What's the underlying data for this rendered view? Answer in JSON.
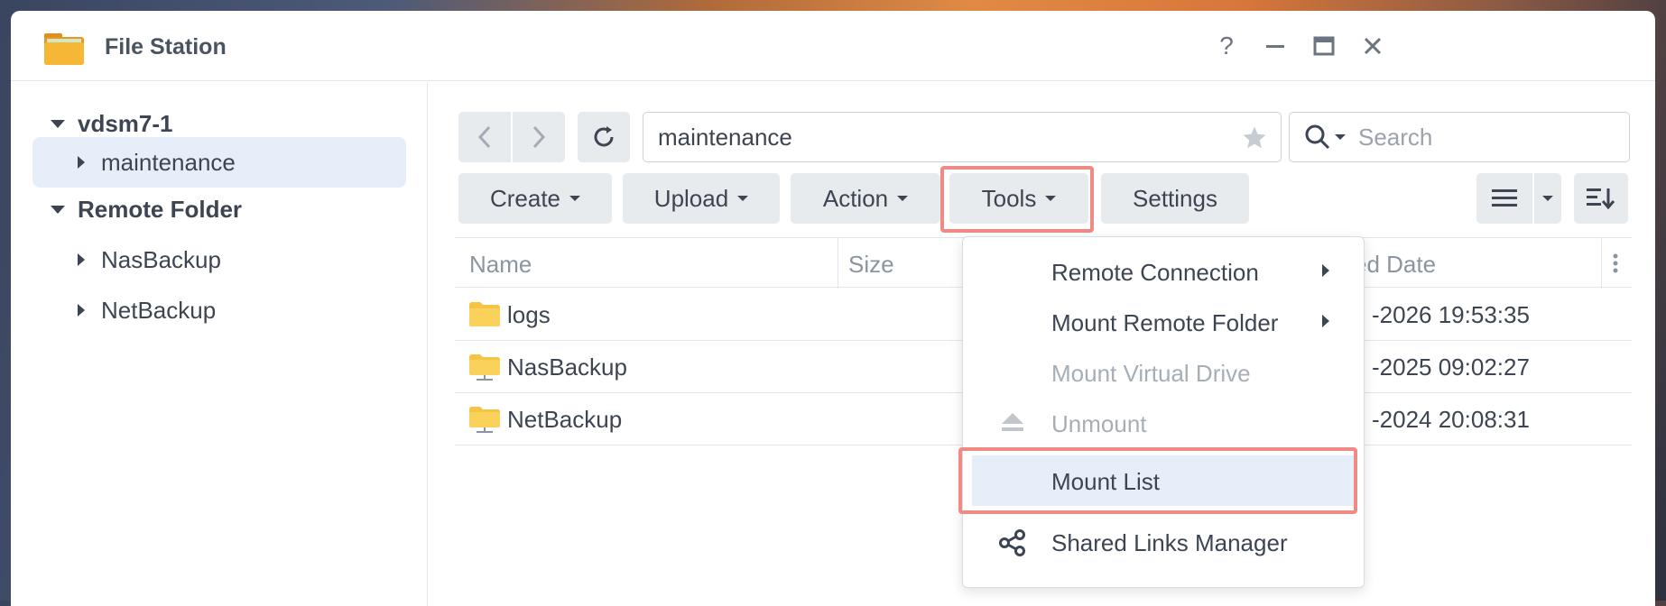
{
  "window": {
    "title": "File Station",
    "help_label": "?"
  },
  "sidebar": {
    "server": "vdsm7-1",
    "items": [
      {
        "label": "maintenance"
      },
      {
        "label": "Remote Folder"
      },
      {
        "label": "NasBackup"
      },
      {
        "label": "NetBackup"
      }
    ]
  },
  "toolbar": {
    "path_value": "maintenance",
    "search_placeholder": "Search",
    "create_label": "Create",
    "upload_label": "Upload",
    "action_label": "Action",
    "tools_label": "Tools",
    "settings_label": "Settings"
  },
  "table": {
    "columns": [
      "Name",
      "Size",
      "ed Date"
    ],
    "rows": [
      {
        "name": "logs",
        "date": "-2026 19:53:35",
        "icon": "folder-icon"
      },
      {
        "name": "NasBackup",
        "date": "-2025 09:02:27",
        "icon": "remote-folder-icon"
      },
      {
        "name": "NetBackup",
        "date": "-2024 20:08:31",
        "icon": "remote-folder-icon"
      }
    ]
  },
  "tools_menu": {
    "items": [
      {
        "label": "Remote Connection",
        "submenu": true,
        "disabled": false
      },
      {
        "label": "Mount Remote Folder",
        "submenu": true,
        "disabled": false
      },
      {
        "label": "Mount Virtual Drive",
        "submenu": false,
        "disabled": true
      },
      {
        "label": "Unmount",
        "submenu": false,
        "disabled": true,
        "icon": "eject-icon"
      },
      {
        "label": "Mount List",
        "submenu": false,
        "disabled": false,
        "highlighted": true
      },
      {
        "label": "Shared Links Manager",
        "submenu": false,
        "disabled": false,
        "icon": "share-icon"
      }
    ]
  },
  "colors": {
    "accent_highlight": "#f08a85",
    "selection": "#e6eff9",
    "folder": "#f6c445"
  }
}
